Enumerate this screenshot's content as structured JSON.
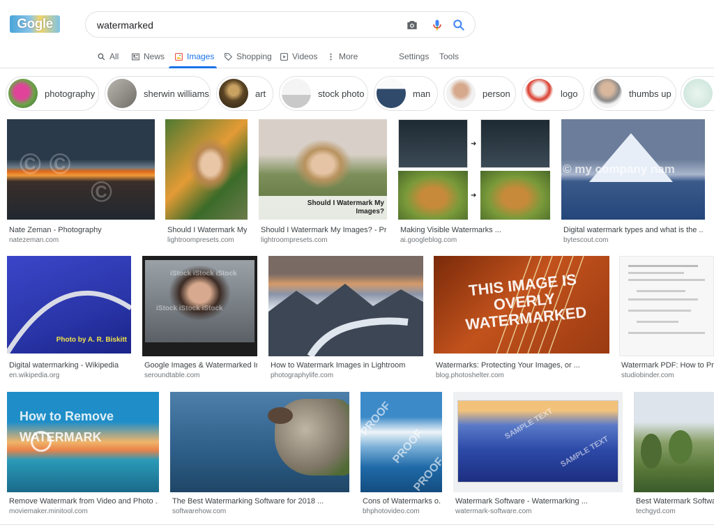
{
  "logo": {
    "text": "Gogle"
  },
  "search": {
    "query": "watermarked",
    "placeholder": ""
  },
  "tabs": [
    {
      "label": "All",
      "icon": "search-icon"
    },
    {
      "label": "News",
      "icon": "news-icon"
    },
    {
      "label": "Images",
      "icon": "image-icon",
      "active": true
    },
    {
      "label": "Shopping",
      "icon": "tag-icon"
    },
    {
      "label": "Videos",
      "icon": "play-icon"
    },
    {
      "label": "More",
      "icon": "more-vert-icon"
    },
    {
      "label": "Settings"
    },
    {
      "label": "Tools"
    }
  ],
  "chips": [
    {
      "label": "photography"
    },
    {
      "label": "sherwin williams"
    },
    {
      "label": "art"
    },
    {
      "label": "stock photo"
    },
    {
      "label": "man"
    },
    {
      "label": "person"
    },
    {
      "label": "logo"
    },
    {
      "label": "thumbs up"
    },
    {
      "label": ""
    }
  ],
  "results": [
    {
      "title": "Nate Zeman - Photography",
      "source": "natezeman.com"
    },
    {
      "title": "Should I Watermark My ...",
      "source": "lightroompresets.com"
    },
    {
      "title": "Should I Watermark My Images? - Pret...",
      "source": "lightroompresets.com",
      "overlay": "Should I Watermark My Images?"
    },
    {
      "title": "Making Visible Watermarks ...",
      "source": "ai.googleblog.com"
    },
    {
      "title": "Digital watermark types and what is the ...",
      "source": "bytescout.com",
      "overlay": "© my company nam"
    },
    {
      "title": "Digital watermarking - Wikipedia",
      "source": "en.wikipedia.org",
      "overlay": "Photo by A. R. Biskitt"
    },
    {
      "title": "Google Images & Watermarked Im...",
      "source": "seroundtable.com"
    },
    {
      "title": "How to Watermark Images in Lightroom",
      "source": "photographylife.com"
    },
    {
      "title": "Watermarks: Protecting Your Images, or ...",
      "source": "blog.photoshelter.com",
      "overlay": "THIS IMAGE IS OVERLY WATERMARKED"
    },
    {
      "title": "Watermark PDF: How to Pr...",
      "source": "studiobinder.com"
    },
    {
      "title": "Remove Watermark from Video and Photo ...",
      "source": "moviemaker.minitool.com",
      "overlay": "How to Remove WATERMARK"
    },
    {
      "title": "The Best Watermarking Software for 2018 ...",
      "source": "softwarehow.com"
    },
    {
      "title": "Cons of Watermarks o...",
      "source": "bhphotovideo.com",
      "overlay": "PROOF"
    },
    {
      "title": "Watermark Software - Watermarking ...",
      "source": "watermark-software.com",
      "overlay": "SAMPLE TEXT"
    },
    {
      "title": "Best Watermark Software",
      "source": "techgyd.com"
    }
  ],
  "colors": {
    "accent": "#1a73e8",
    "text_secondary": "#5f6368",
    "border": "#dfe1e5"
  }
}
